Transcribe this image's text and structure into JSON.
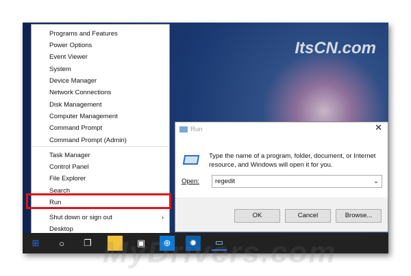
{
  "watermarks": {
    "top": "ItsCN.com",
    "bottom": "MyDrivers.com"
  },
  "menu": {
    "items": [
      "Programs and Features",
      "Power Options",
      "Event Viewer",
      "System",
      "Device Manager",
      "Network Connections",
      "Disk Management",
      "Computer Management",
      "Command Prompt",
      "Command Prompt (Admin)",
      "Task Manager",
      "Control Panel",
      "File Explorer",
      "Search",
      "Run",
      "Shut down or sign out",
      "Desktop"
    ],
    "submenu_arrow": "›"
  },
  "run_dialog": {
    "title": "Run",
    "description": "Type the name of a program, folder, document, or Internet resource, and Windows will open it for you.",
    "open_label": "Open:",
    "open_value": "regedit",
    "ok": "OK",
    "cancel": "Cancel",
    "browse": "Browse...",
    "close": "✕"
  },
  "colors": {
    "highlight": "#e0101a",
    "accent": "#0078d7"
  }
}
